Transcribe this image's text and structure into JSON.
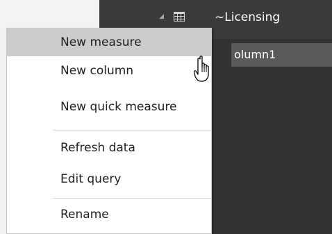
{
  "fields_pane": {
    "table_name": "~Licensing",
    "column_name": "olumn1",
    "table_icon": "table-grid-icon",
    "expand_icon": "expanded-caret-icon"
  },
  "context_menu": {
    "items": [
      {
        "label": "New measure",
        "highlighted": true
      },
      {
        "label": "New column"
      },
      {
        "label": "New quick measure"
      },
      {
        "label": "Refresh data"
      },
      {
        "label": "Edit query"
      },
      {
        "label": "Rename"
      }
    ]
  },
  "cursor": {
    "icon": "hand-pointer-icon"
  },
  "colors": {
    "pane_background": "#333333",
    "menu_highlight": "#cccccc",
    "column_highlight": "#5a5a5a",
    "table_icon": "#d4d4d4"
  }
}
